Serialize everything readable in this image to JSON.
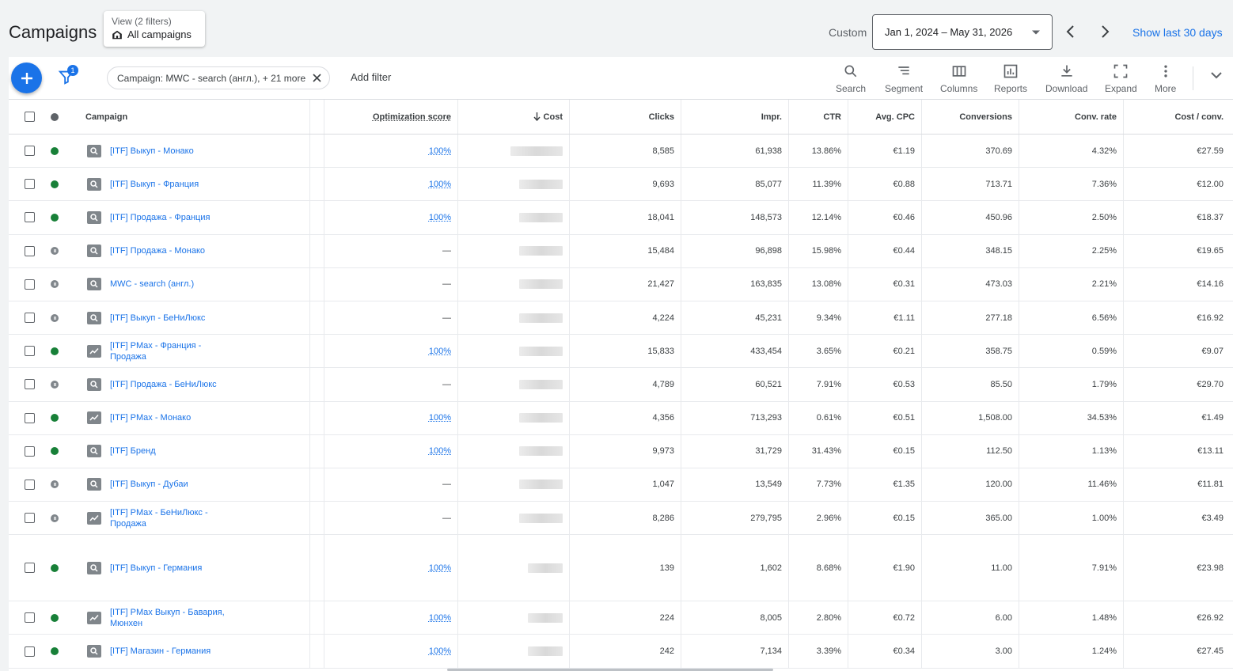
{
  "header": {
    "title": "Campaigns",
    "view_sub": "View (2 filters)",
    "view_main": "All campaigns",
    "custom_label": "Custom",
    "date_range": "Jan 1, 2024 – May 31, 2026",
    "show_last": "Show last 30 days"
  },
  "toolbar": {
    "filter_badge": "1",
    "chip_label": "Campaign: MWC - search (англ.), + 21 more",
    "add_filter": "Add filter",
    "tools": [
      "Search",
      "Segment",
      "Columns",
      "Reports",
      "Download",
      "Expand",
      "More"
    ]
  },
  "columns": {
    "campaign": "Campaign",
    "opt": "Optimization score",
    "cost": "Cost",
    "clicks": "Clicks",
    "impr": "Impr.",
    "ctr": "CTR",
    "cpc": "Avg. CPC",
    "conv": "Conversions",
    "rate": "Conv. rate",
    "cpa": "Cost / conv."
  },
  "rows": [
    {
      "status": "enabled",
      "type": "search",
      "name": "[ITF] Выкуп - Монако",
      "opt": "100%",
      "clicks": "8,585",
      "impr": "61,938",
      "ctr": "13.86%",
      "cpc": "€1.19",
      "conv": "370.69",
      "rate": "4.32%",
      "cpa": "€27.59"
    },
    {
      "status": "enabled",
      "type": "search",
      "name": "[ITF] Выкуп - Франция",
      "opt": "100%",
      "clicks": "9,693",
      "impr": "85,077",
      "ctr": "11.39%",
      "cpc": "€0.88",
      "conv": "713.71",
      "rate": "7.36%",
      "cpa": "€12.00"
    },
    {
      "status": "enabled",
      "type": "search",
      "name": "[ITF] Продажа - Франция",
      "opt": "100%",
      "clicks": "18,041",
      "impr": "148,573",
      "ctr": "12.14%",
      "cpc": "€0.46",
      "conv": "450.96",
      "rate": "2.50%",
      "cpa": "€18.37"
    },
    {
      "status": "paused",
      "type": "search",
      "name": "[ITF] Продажа - Монако",
      "opt": "—",
      "clicks": "15,484",
      "impr": "96,898",
      "ctr": "15.98%",
      "cpc": "€0.44",
      "conv": "348.15",
      "rate": "2.25%",
      "cpa": "€19.65"
    },
    {
      "status": "paused",
      "type": "search",
      "name": "MWC - search (англ.)",
      "opt": "—",
      "clicks": "21,427",
      "impr": "163,835",
      "ctr": "13.08%",
      "cpc": "€0.31",
      "conv": "473.03",
      "rate": "2.21%",
      "cpa": "€14.16"
    },
    {
      "status": "paused",
      "type": "search",
      "name": "[ITF] Выкуп - БеНиЛюкс",
      "opt": "—",
      "clicks": "4,224",
      "impr": "45,231",
      "ctr": "9.34%",
      "cpc": "€1.11",
      "conv": "277.18",
      "rate": "6.56%",
      "cpa": "€16.92"
    },
    {
      "status": "enabled",
      "type": "pmax",
      "name": "[ITF] PMax - Франция - Продажа",
      "opt": "100%",
      "clicks": "15,833",
      "impr": "433,454",
      "ctr": "3.65%",
      "cpc": "€0.21",
      "conv": "358.75",
      "rate": "0.59%",
      "cpa": "€9.07"
    },
    {
      "status": "paused",
      "type": "search",
      "name": "[ITF] Продажа - БеНиЛюкс",
      "opt": "—",
      "clicks": "4,789",
      "impr": "60,521",
      "ctr": "7.91%",
      "cpc": "€0.53",
      "conv": "85.50",
      "rate": "1.79%",
      "cpa": "€29.70"
    },
    {
      "status": "enabled",
      "type": "pmax",
      "name": "[ITF] PMax - Монако",
      "opt": "100%",
      "clicks": "4,356",
      "impr": "713,293",
      "ctr": "0.61%",
      "cpc": "€0.51",
      "conv": "1,508.00",
      "rate": "34.53%",
      "cpa": "€1.49"
    },
    {
      "status": "enabled",
      "type": "search",
      "name": "[ITF] Бренд",
      "opt": "100%",
      "clicks": "9,973",
      "impr": "31,729",
      "ctr": "31.43%",
      "cpc": "€0.15",
      "conv": "112.50",
      "rate": "1.13%",
      "cpa": "€13.11"
    },
    {
      "status": "paused",
      "type": "search",
      "name": "[ITF] Выкуп - Дубаи",
      "opt": "—",
      "clicks": "1,047",
      "impr": "13,549",
      "ctr": "7.73%",
      "cpc": "€1.35",
      "conv": "120.00",
      "rate": "11.46%",
      "cpa": "€11.81"
    },
    {
      "status": "paused",
      "type": "pmax",
      "name": "[ITF] PMax - БеНиЛюкс - Продажа",
      "opt": "—",
      "clicks": "8,286",
      "impr": "279,795",
      "ctr": "2.96%",
      "cpc": "€0.15",
      "conv": "365.00",
      "rate": "1.00%",
      "cpa": "€3.49"
    },
    {
      "status": "enabled",
      "type": "search",
      "name": "[ITF] Выкуп - Германия",
      "opt": "100%",
      "clicks": "139",
      "impr": "1,602",
      "ctr": "8.68%",
      "cpc": "€1.90",
      "conv": "11.00",
      "rate": "7.91%",
      "cpa": "€23.98"
    },
    {
      "status": "enabled",
      "type": "pmax",
      "name": "[ITF] PMax Выкуп - Бавария, Мюнхен",
      "opt": "100%",
      "clicks": "224",
      "impr": "8,005",
      "ctr": "2.80%",
      "cpc": "€0.72",
      "conv": "6.00",
      "rate": "1.48%",
      "cpa": "€26.92"
    },
    {
      "status": "enabled",
      "type": "search",
      "name": "[ITF] Магазин - Германия",
      "opt": "100%",
      "clicks": "242",
      "impr": "7,134",
      "ctr": "3.39%",
      "cpc": "€0.34",
      "conv": "3.00",
      "rate": "1.24%",
      "cpa": "€27.45"
    }
  ],
  "colors": {
    "accent": "#1a73e8",
    "enabled": "#188038",
    "paused": "#80868b"
  }
}
